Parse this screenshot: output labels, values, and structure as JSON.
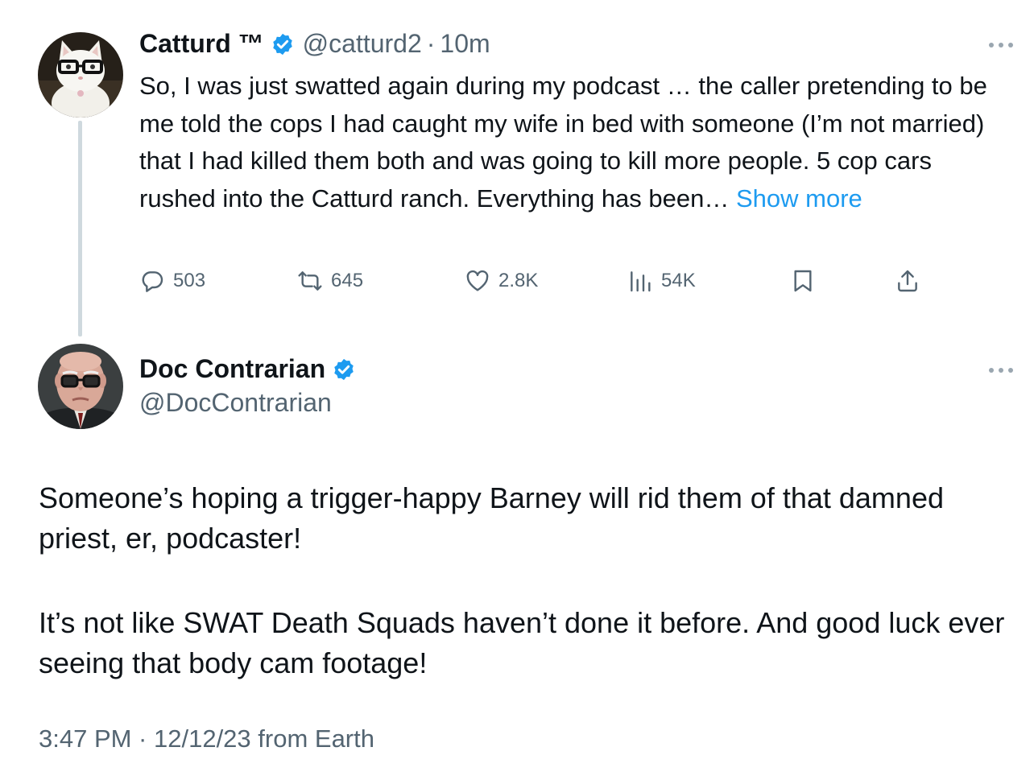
{
  "quoted_tweet": {
    "display_name": "Catturd ™",
    "handle": "@catturd2",
    "separator": "·",
    "time": "10m",
    "text": "So, I was just swatted again during my podcast … the caller pretending to be me told the cops I had caught my wife in bed with someone (I’m not married) that I had killed them both and was going to kill more people. 5 cop cars rushed into the Catturd ranch. Everything has been…",
    "show_more_label": "Show more",
    "avatar_icon": "cat-with-glasses-avatar",
    "verified_icon": "verified-badge-icon",
    "actions": {
      "replies": "503",
      "reposts": "645",
      "likes": "2.8K",
      "views": "54K"
    }
  },
  "reply_tweet": {
    "display_name": "Doc Contrarian",
    "handle": "@DocContrarian",
    "avatar_icon": "old-man-with-glasses-avatar",
    "verified_icon": "verified-badge-icon",
    "paragraphs": [
      "Someone’s hoping a trigger-happy Barney will rid them of that damned priest, er, podcaster!",
      "It’s not like SWAT Death Squads haven’t done it before. And good luck ever seeing that body cam footage!"
    ],
    "timestamp": "3:47 PM · 12/12/23 from Earth"
  },
  "colors": {
    "text": "#0f1419",
    "secondary": "#536471",
    "link": "#1d9bf0",
    "verified": "#1d9bf0",
    "thread_line": "#cfd9de"
  }
}
